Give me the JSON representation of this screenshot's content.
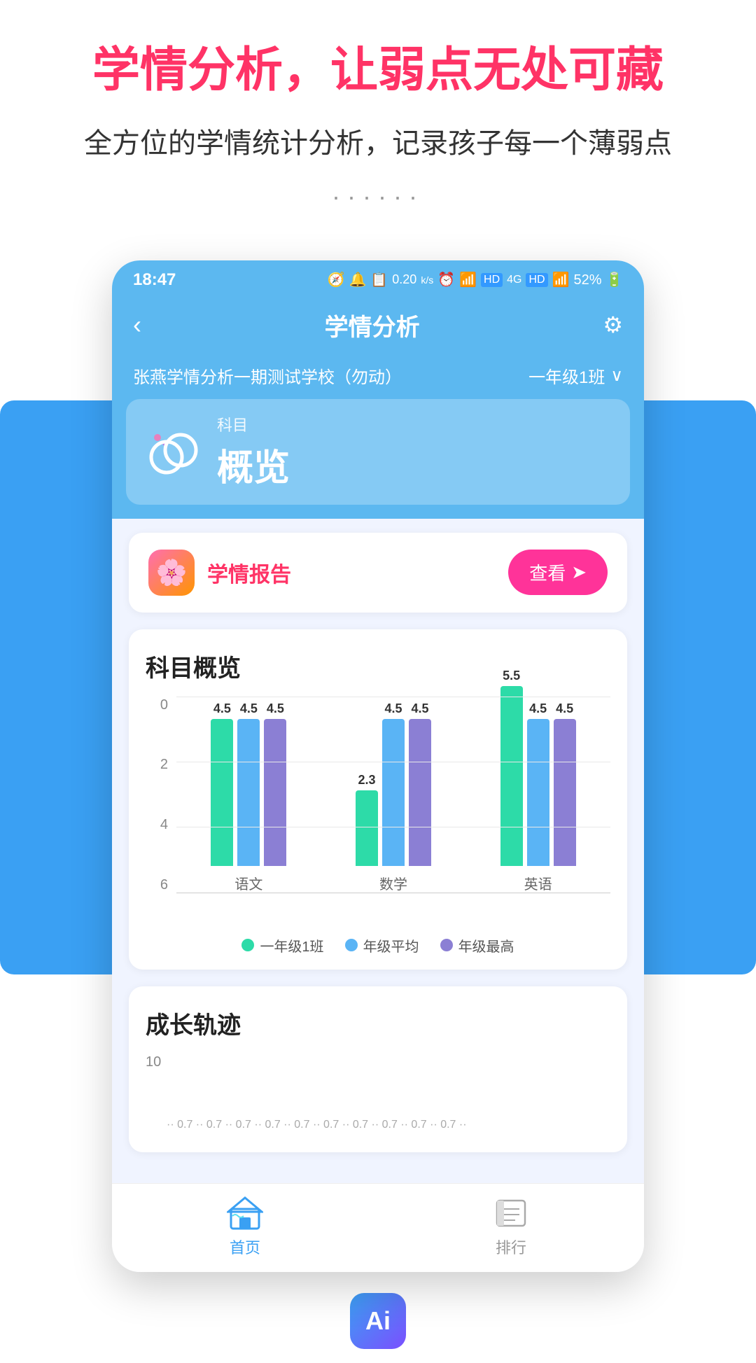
{
  "page": {
    "main_title": "学情分析，让弱点无处可藏",
    "sub_title": "全方位的学情统计分析，记录孩子每一个薄弱点",
    "dots": "······"
  },
  "status_bar": {
    "time": "18:47",
    "icons": "0.20 k/s  ⏰  📶  HD  4G  HD  📶  52% 🔋"
  },
  "header": {
    "back_label": "‹",
    "title": "学情分析",
    "settings_label": "⚙"
  },
  "school_bar": {
    "name": "张燕学情分析一期测试学校（勿动）",
    "class": "一年级1班",
    "dropdown": "∨"
  },
  "subject_tab": {
    "label": "科目",
    "main_text": "概览",
    "dots_decor": "·· ·"
  },
  "report": {
    "icon": "🌸",
    "title": "学情报告",
    "view_btn": "查看",
    "arrow": "⊙"
  },
  "chart_overview": {
    "section_title": "科目概览",
    "y_labels": [
      "6",
      "4",
      "2",
      "0"
    ],
    "subjects": [
      {
        "name": "语文",
        "bars": [
          {
            "label": "一年级1班",
            "value": 4.5,
            "color": "green"
          },
          {
            "label": "年级平均",
            "value": 4.5,
            "color": "blue"
          },
          {
            "label": "年级最高",
            "value": 4.5,
            "color": "purple"
          }
        ]
      },
      {
        "name": "数学",
        "bars": [
          {
            "label": "一年级1班",
            "value": 2.3,
            "color": "green"
          },
          {
            "label": "年级平均",
            "value": 4.5,
            "color": "blue"
          },
          {
            "label": "年级最高",
            "value": 4.5,
            "color": "purple"
          }
        ]
      },
      {
        "name": "英语",
        "bars": [
          {
            "label": "一年级1班",
            "value": 5.5,
            "color": "green"
          },
          {
            "label": "年级平均",
            "value": 4.5,
            "color": "blue"
          },
          {
            "label": "年级最高",
            "value": 4.5,
            "color": "purple"
          }
        ]
      }
    ],
    "legend": [
      {
        "label": "一年级1班",
        "color": "#2ddba8"
      },
      {
        "label": "年级平均",
        "color": "#5ab4f5"
      },
      {
        "label": "年级最高",
        "color": "#8b7fd4"
      }
    ],
    "max_value": 6
  },
  "growth": {
    "section_title": "成长轨迹",
    "y_label_top": "10"
  },
  "bottom_nav": {
    "items": [
      {
        "label": "首页",
        "active": true,
        "icon": "home"
      },
      {
        "label": "排行",
        "active": false,
        "icon": "rank"
      }
    ]
  },
  "ai_badge": {
    "label": "Ai"
  }
}
